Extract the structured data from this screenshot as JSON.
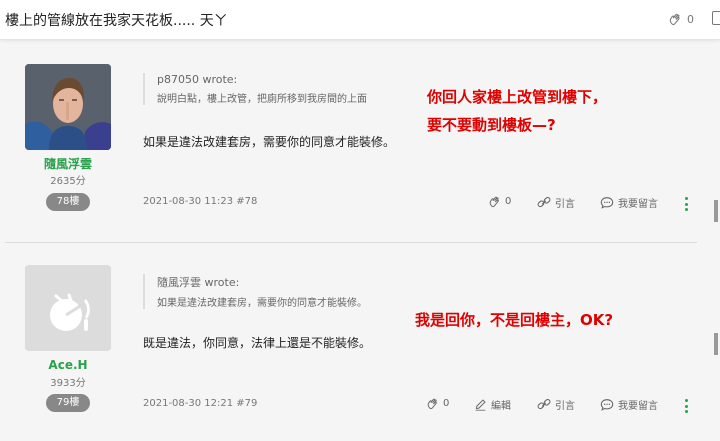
{
  "topbar": {
    "title": "樓上的管線放在我家天花板..... 天ㄚ",
    "like_count": "0"
  },
  "posts": [
    {
      "username": "隨風浮雲",
      "points": "2635分",
      "floor": "78樓",
      "quote_header": "p87050 wrote:",
      "quote_text": "說明白點，樓上改管，把廁所移到我房間的上面",
      "body": "如果是違法改建套房，需要你的同意才能裝修。",
      "red_note_1": "你回人家樓上改管到樓下，",
      "red_note_2": "要不要動到樓板—?",
      "datetime": "2021-08-30 11:23 #78",
      "likes": "0",
      "quote_label": "引言",
      "reply_label": "我要留言"
    },
    {
      "username": "Ace.H",
      "points": "3933分",
      "floor": "79樓",
      "quote_header": "隨風浮雲 wrote:",
      "quote_text": "如果是違法改建套房，需要你的同意才能裝修。",
      "body": "既是違法，你同意，法律上還是不能裝修。",
      "red_note": "我是回你，不是回樓主，OK?",
      "datetime": "2021-08-30 12:21 #79",
      "likes": "0",
      "edit_label": "編輯",
      "quote_label": "引言",
      "reply_label": "我要留言"
    }
  ],
  "colors": {
    "accent_green": "#2aa14a",
    "annotation_red": "#e00000",
    "badge_gray": "#888888"
  }
}
